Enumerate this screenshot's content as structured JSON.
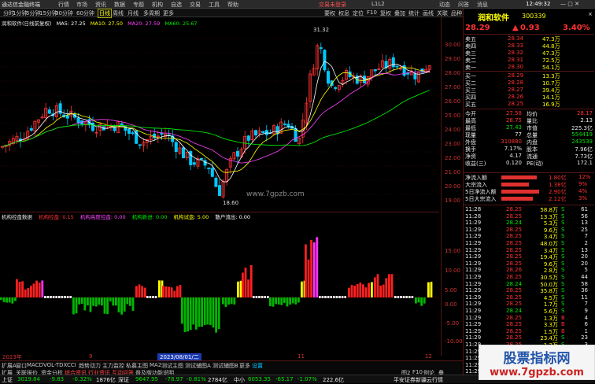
{
  "titlebar": {
    "app": "通达信金融终端",
    "menus": [
      "行情",
      "市场",
      "资讯",
      "数据",
      "专题",
      "机构",
      "自选",
      "交易",
      "工具",
      "帮助"
    ],
    "alert": "交易未登录",
    "center": "L1L2",
    "time": "12:49:32",
    "links": [
      "动态",
      "问答",
      "消息"
    ]
  },
  "periods": [
    "分时",
    "1分钟",
    "5分钟",
    "15分钟",
    "30分钟",
    "60分钟",
    "日线",
    "周线",
    "月线",
    "多周期",
    "更多"
  ],
  "toolbar_right": [
    "要权",
    "权息",
    "定位",
    "F10",
    "复权",
    "叠加",
    "统计",
    "画线",
    "关联",
    "品种",
    "返回"
  ],
  "stock": {
    "name": "润和软件",
    "code": "300339",
    "price": "28.29",
    "change": "0.93",
    "pct": "3.40%"
  },
  "ma_legend": {
    "title": "润和软件(日线前复权)",
    "items": [
      {
        "label": "MA5: 27.25",
        "color": "#ffffff"
      },
      {
        "label": "MA10: 27.50",
        "color": "#ffff00"
      },
      {
        "label": "MA20: 27.59",
        "color": "#ff44ff"
      },
      {
        "label": "MA60: 25.67",
        "color": "#00e600"
      }
    ]
  },
  "annotations": {
    "high": "31.32",
    "low": "18.60",
    "watermark_mid": "www.7gpzb.com",
    "watermark_brand": "股票指标网",
    "watermark_url": "www.7gpzb.com"
  },
  "price_scale": [
    "30.00",
    "29.00",
    "28.00",
    "27.00",
    "26.00",
    "25.00",
    "24.00",
    "23.00",
    "22.00",
    "21.00",
    "20.00",
    "19.00"
  ],
  "ind_scale": [
    "15.00",
    "10.00",
    "5.00",
    "0.00",
    "-5.00",
    "-10.00"
  ],
  "indicator_legend": {
    "title": "机构控盘数据",
    "items": [
      {
        "label": "机构控盘: 0.15",
        "color": "#ff3232"
      },
      {
        "label": "机构高度控盘: 0.00",
        "color": "#ff44ff"
      },
      {
        "label": "机构新进: 0.00",
        "color": "#00e600"
      },
      {
        "label": "机构试盘: 5.00",
        "color": "#ffff00"
      },
      {
        "label": "散户流出: 0.00",
        "color": "#ffffff"
      }
    ]
  },
  "order_book": {
    "sells": [
      {
        "label": "卖五",
        "price": "28.34",
        "vol": "47.3万"
      },
      {
        "label": "卖四",
        "price": "28.33",
        "vol": "44.8万"
      },
      {
        "label": "卖三",
        "price": "28.32",
        "vol": "47.3万"
      },
      {
        "label": "卖二",
        "price": "28.31",
        "vol": "72.5万"
      },
      {
        "label": "卖一",
        "price": "28.30",
        "vol": "54.1万"
      }
    ],
    "buys": [
      {
        "label": "买一",
        "price": "28.29",
        "vol": "13.3万"
      },
      {
        "label": "买二",
        "price": "28.28",
        "vol": "10.7万"
      },
      {
        "label": "买三",
        "price": "28.27",
        "vol": "39.4万"
      },
      {
        "label": "买四",
        "price": "28.26",
        "vol": "14.1万"
      },
      {
        "label": "买五",
        "price": "28.25",
        "vol": "16.9万"
      }
    ]
  },
  "quote": [
    {
      "k1": "今开",
      "v1": "27.58",
      "k2": "均价",
      "v2": "28.17"
    },
    {
      "k1": "最高",
      "v1": "28.75",
      "k2": "量比",
      "v2": "2.13"
    },
    {
      "k1": "最低",
      "v1": "27.43",
      "k2": "市值",
      "v2": "225.3亿"
    },
    {
      "k1": "现量",
      "v1": "77",
      "k2": "总量",
      "v2": "554419"
    },
    {
      "k1": "外盘",
      "v1": "310880",
      "k2": "内盘",
      "v2": "243539"
    },
    {
      "k1": "换手",
      "v1": "7.17%",
      "k2": "股本",
      "v2": "7.96亿"
    },
    {
      "k1": "净资",
      "v1": "4.17",
      "k2": "流通",
      "v2": "7.73亿"
    },
    {
      "k1": "收益(三)",
      "v1": "0.120",
      "k2": "PE(动)",
      "v2": "172.1"
    }
  ],
  "flows": [
    {
      "label": "净流入额",
      "val": "1.80亿",
      "pct": "12%",
      "bar": 0.9
    },
    {
      "label": "大宗流入",
      "val": "1.38亿",
      "pct": "9%",
      "bar": 0.7
    },
    {
      "label": "5日净流入额",
      "val": "2.90亿",
      "pct": "4%",
      "bar": 0.95
    },
    {
      "label": "5日大宗流入",
      "val": "2.12亿",
      "pct": "3%",
      "bar": 0.8
    }
  ],
  "ticks": [
    {
      "t": "11:28",
      "p": "28.25",
      "v": "58.8万",
      "f": "S",
      "n": "61"
    },
    {
      "t": "11:28",
      "p": "28.25",
      "v": "13.3万",
      "f": "S",
      "n": "56"
    },
    {
      "t": "11:29",
      "p": "28.24",
      "v": "5.3万",
      "f": "S",
      "n": "13"
    },
    {
      "t": "11:29",
      "p": "28.25",
      "v": "9.6万",
      "f": "S",
      "n": "25"
    },
    {
      "t": "11:29",
      "p": "28.25",
      "v": "3.4万",
      "f": "S",
      "n": "7"
    },
    {
      "t": "11:29",
      "p": "28.25",
      "v": "48.0万",
      "f": "S",
      "n": "2"
    },
    {
      "t": "11:29",
      "p": "28.25",
      "v": "3.4万",
      "f": "S",
      "n": "13"
    },
    {
      "t": "11:29",
      "p": "28.25",
      "v": "19.4万",
      "f": "S",
      "n": "20"
    },
    {
      "t": "11:29",
      "p": "28.25",
      "v": "9.6万",
      "f": "S",
      "n": "20"
    },
    {
      "t": "11:29",
      "p": "28.26",
      "v": "2.8万",
      "f": "S",
      "n": "5"
    },
    {
      "t": "11:29",
      "p": "28.25",
      "v": "30.5万",
      "f": "S",
      "n": "44"
    },
    {
      "t": "11:29",
      "p": "28.24",
      "v": "50.0万",
      "f": "S",
      "n": "58"
    },
    {
      "t": "11:29",
      "p": "28.25",
      "v": "35.8万",
      "f": "S",
      "n": "36"
    },
    {
      "t": "11:29",
      "p": "28.25",
      "v": "4.5万",
      "f": "S",
      "n": "11"
    },
    {
      "t": "11:29",
      "p": "28.25",
      "v": "1.7万",
      "f": "S",
      "n": "7"
    },
    {
      "t": "11:29",
      "p": "28.24",
      "v": "5.6万",
      "f": "S",
      "n": "9"
    },
    {
      "t": "11:29",
      "p": "28.25",
      "v": "1.3万",
      "f": "B",
      "n": "4"
    },
    {
      "t": "11:29",
      "p": "28.25",
      "v": "3.3万",
      "f": "B",
      "n": "6"
    },
    {
      "t": "11:29",
      "p": "28.25",
      "v": "1.5万",
      "f": "B",
      "n": "1"
    },
    {
      "t": "11:29",
      "p": "28.25",
      "v": "23.4万",
      "f": "S",
      "n": "23"
    },
    {
      "t": "11:29",
      "p": "28.25",
      "v": "1.3万",
      "f": "S",
      "n": "3"
    },
    {
      "t": "11:29",
      "p": "28.25",
      "v": "5.3万",
      "f": "S",
      "n": "7"
    },
    {
      "t": "11:29",
      "p": "28.25",
      "v": "5.6万",
      "f": "S",
      "n": "7"
    },
    {
      "t": "11:29",
      "p": "28.25",
      "v": "3.5万",
      "f": "S",
      "n": "11"
    },
    {
      "t": "11:29",
      "p": "28.25",
      "v": "3.0万",
      "f": "S",
      "n": "5"
    },
    {
      "t": "11:29",
      "p": "28.25",
      "v": "2.9万",
      "f": "S",
      "n": "3"
    }
  ],
  "date_axis": {
    "start": "2023年",
    "m9": "9",
    "m7": "7",
    "current": "2023/08/01/二",
    "m11": "11",
    "m12": "12"
  },
  "bottom_tabs": [
    "扩展A",
    "窗口",
    "MACD",
    "VOL-TDX",
    "CCI",
    "趋势动力",
    "主力监控",
    "私募主图",
    "MA2",
    "测试主图",
    "测试辅图A",
    "测试辅图B",
    "更多",
    "设置"
  ],
  "bottom_tabs2": [
    "扩展",
    "关联报价",
    "资金分析",
    "综合资讯",
    "行业资讯",
    "互动问答",
    "普及版功能说明"
  ],
  "bottom_right": [
    "图2",
    "F10",
    "例论",
    "叠"
  ],
  "status": {
    "sh": {
      "name": "上证",
      "val": "3019.84",
      "chg": "-9.83",
      "pct": "-0.32%",
      "amt": "1876亿"
    },
    "sz": {
      "name": "深证",
      "val": "9647.95",
      "chg": "-78.97",
      "pct": "-0.81%",
      "amt": "2784亿"
    },
    "zx": {
      "name": "中小",
      "val": "6053.35",
      "chg": "-65.17",
      "pct": "-1.07%",
      "amt": "222.6亿"
    },
    "right": "平安证券新疆云行情"
  },
  "colors": {
    "up": "#ff3232",
    "down": "#00e600",
    "ma5": "#ffffff",
    "ma10": "#ffff00",
    "ma20": "#ff44ff",
    "ma60": "#00e600",
    "bg": "#000000"
  }
}
